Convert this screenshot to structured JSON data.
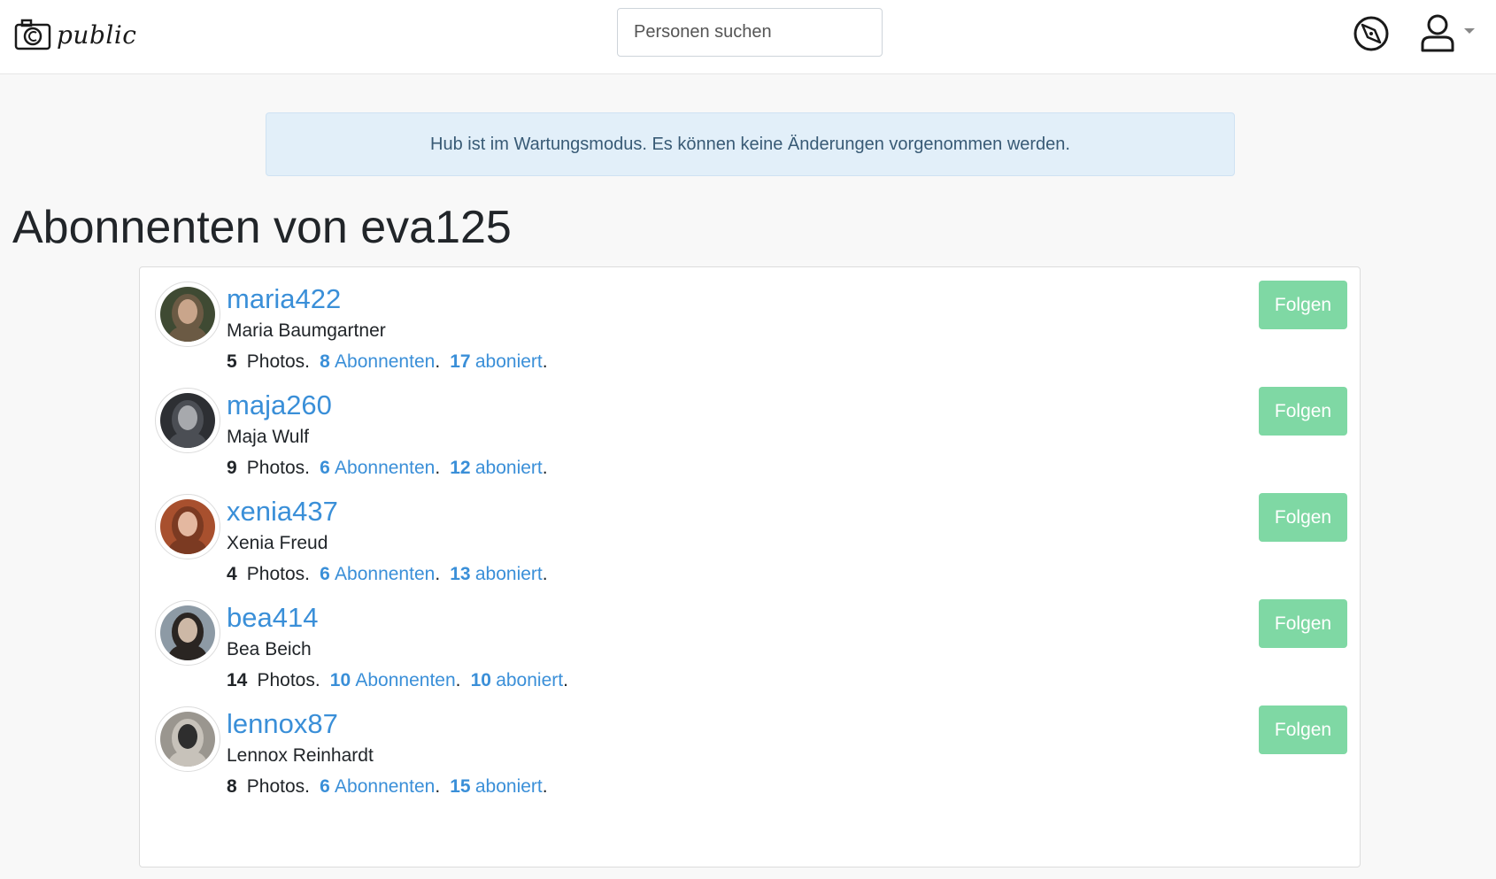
{
  "navbar": {
    "brand_text": "public",
    "search_placeholder": "Personen suchen"
  },
  "alert": {
    "message": "Hub ist im Wartungsmodus. Es können keine Änderungen vorgenommen werden."
  },
  "page": {
    "title": "Abonnenten von eva125"
  },
  "follow_label": "Folgen",
  "labels": {
    "photos": "Photos.",
    "followers": "Abonnenten",
    "following": "aboniert",
    "dot": "."
  },
  "users": [
    {
      "username": "maria422",
      "fullname": "Maria Baumgartner",
      "photos": "5",
      "followers": "8",
      "following": "17",
      "avatar_colors": [
        "#3f4a33",
        "#c9a58b",
        "#6b5a44"
      ]
    },
    {
      "username": "maja260",
      "fullname": "Maja Wulf",
      "photos": "9",
      "followers": "6",
      "following": "12",
      "avatar_colors": [
        "#2d2f33",
        "#a7a9ad",
        "#4b4e54"
      ]
    },
    {
      "username": "xenia437",
      "fullname": "Xenia Freud",
      "photos": "4",
      "followers": "6",
      "following": "13",
      "avatar_colors": [
        "#a8502e",
        "#e4b8a0",
        "#7b3a22"
      ]
    },
    {
      "username": "bea414",
      "fullname": "Bea Beich",
      "photos": "14",
      "followers": "10",
      "following": "10",
      "avatar_colors": [
        "#8d9aa5",
        "#cdb8a6",
        "#2a2522"
      ]
    },
    {
      "username": "lennox87",
      "fullname": "Lennox Reinhardt",
      "photos": "8",
      "followers": "6",
      "following": "15",
      "avatar_colors": [
        "#9a968f",
        "#2e2e2e",
        "#c7c2ba"
      ]
    }
  ]
}
